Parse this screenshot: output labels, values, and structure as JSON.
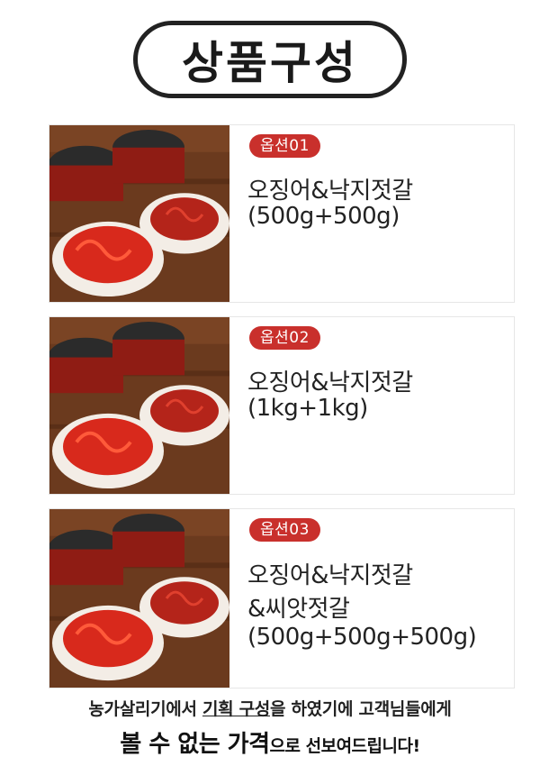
{
  "header": {
    "title": "상품구성"
  },
  "options": [
    {
      "badge": "옵션01",
      "lines": [
        "오징어&낙지젓갈",
        "(500g+500g)"
      ]
    },
    {
      "badge": "옵션02",
      "lines": [
        "오징어&낙지젓갈",
        "(1kg+1kg)"
      ]
    },
    {
      "badge": "옵션03",
      "lines": [
        "오징어&낙지젓갈",
        "&씨앗젓갈",
        "(500g+500g+500g)"
      ]
    }
  ],
  "footer": {
    "line1_a": "농가살리기에서 ",
    "line1_b": "기획 구성",
    "line1_c": "을 하였기에  고객님들에게",
    "line2_a": "볼 수 없는 가격",
    "line2_b": "으로 선보여드립니다!"
  },
  "colors": {
    "badge": "#c9302c",
    "border": "#222222"
  },
  "image": {
    "name": "jeotgal-product-photo"
  }
}
